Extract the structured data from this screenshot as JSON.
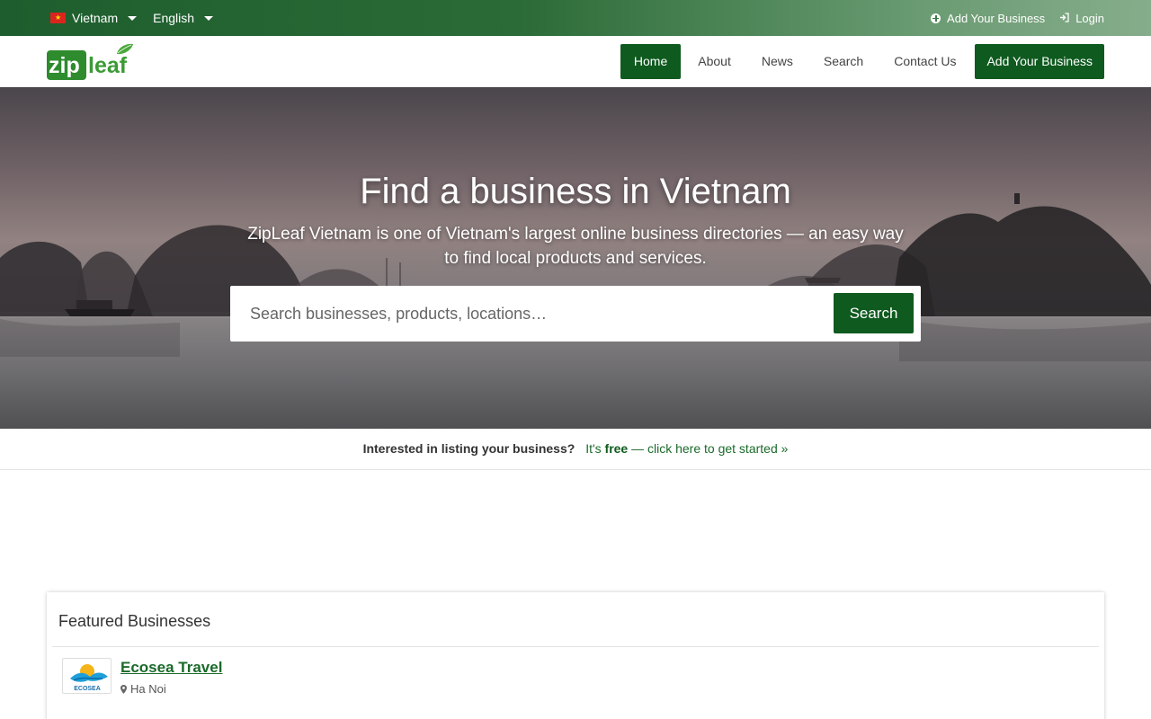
{
  "topbar": {
    "country": "Vietnam",
    "language": "English",
    "add_business": "Add Your Business",
    "login": "Login"
  },
  "logo": {
    "text_zip": "zip",
    "text_leaf": "leaf"
  },
  "nav": {
    "items": [
      "Home",
      "About",
      "News",
      "Search",
      "Contact Us"
    ],
    "active": "Home",
    "cta": "Add Your Business"
  },
  "hero": {
    "title": "Find a business in Vietnam",
    "subtitle": "ZipLeaf Vietnam is one of Vietnam's largest online business directories — an easy way to find local products and services.",
    "search_placeholder": "Search businesses, products, locations…",
    "search_button": "Search"
  },
  "promo": {
    "question": "Interested in listing your business?",
    "link_prefix": "It's ",
    "link_free": "free",
    "link_suffix": " — click here to get started »"
  },
  "featured": {
    "heading": "Featured Businesses",
    "businesses": [
      {
        "name": "Ecosea Travel",
        "location": "Ha Noi",
        "logo_text": "ECOSEA"
      }
    ]
  },
  "colors": {
    "brand_green": "#0f5a1f",
    "link_green": "#1a6a2a",
    "topbar_start": "#1e5e2e",
    "flag_red": "#d9251d"
  },
  "icons": [
    "flag-vietnam-icon",
    "caret-down-icon",
    "plus-circle-icon",
    "login-icon",
    "map-marker-icon"
  ]
}
